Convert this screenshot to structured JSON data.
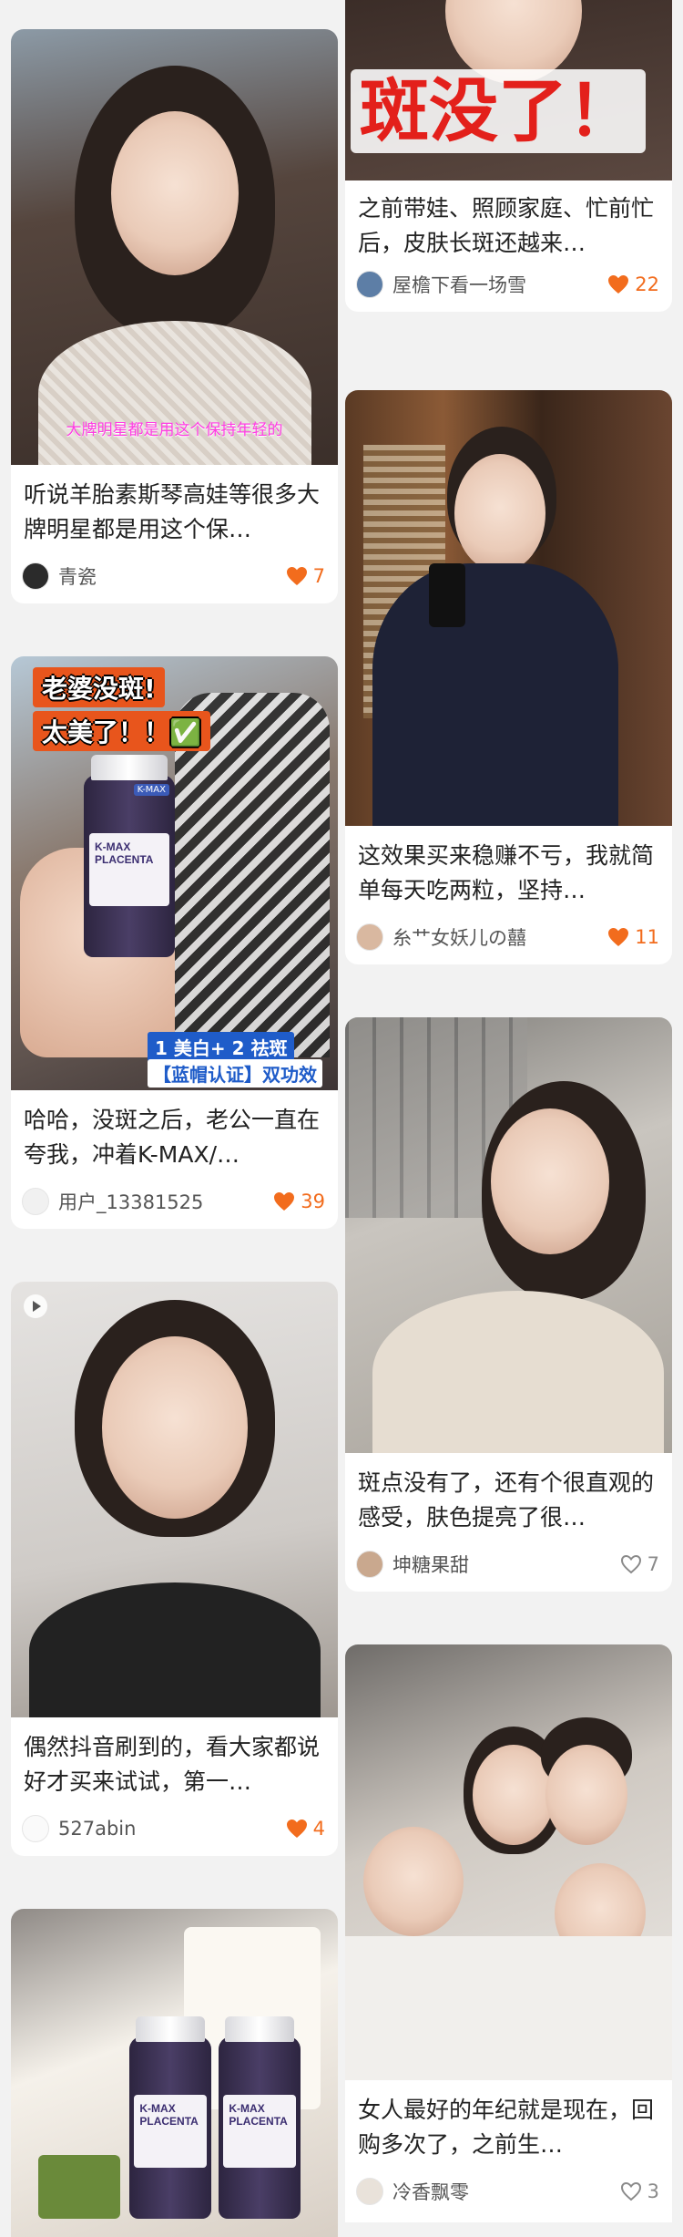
{
  "colors": {
    "like_active": "#f26c1d",
    "like_inactive": "#8a8a8a",
    "background": "#f2f2f2"
  },
  "cards": {
    "left": [
      {
        "title": "听说羊胎素斯琴高娃等很多大牌明星都是用这个保…",
        "user": "青瓷",
        "likes": "7",
        "liked": true,
        "image_caption": "大牌明星都是用这个保持年轻的"
      },
      {
        "title": "哈哈，没斑之后，老公一直在夸我，冲着K-MAX/…",
        "user": "用户_13381525",
        "likes": "39",
        "liked": true,
        "sticker_1": "老婆没斑!",
        "sticker_2": "太美了！！✅",
        "bottle_brand": "K-MAX",
        "bottle_line1": "K-MAX",
        "bottle_line2": "PLACENTA",
        "badge_1": "1 美白+ 2 祛斑",
        "badge_2": "【蓝帽认证】双功效"
      },
      {
        "title": "偶然抖音刷到的，看大家都说好才买来试试，第一…",
        "user": "527abin",
        "likes": "4",
        "liked": true,
        "has_video": true
      },
      {
        "title": "",
        "user": "",
        "likes": "",
        "bottle_line1": "K-MAX",
        "bottle_line2": "PLACENTA"
      }
    ],
    "right": [
      {
        "title": "之前带娃、照顾家庭、忙前忙后，皮肤长斑还越来…",
        "user": "屋檐下看一场雪",
        "likes": "22",
        "liked": true,
        "banner": "斑没了！"
      },
      {
        "title": "这效果买来稳赚不亏，我就简单每天吃两粒，坚持…",
        "user": "糸艹女妖儿の囍",
        "likes": "11",
        "liked": true
      },
      {
        "title": "斑点没有了，还有个很直观的感受，肤色提亮了很…",
        "user": "坤糖果甜",
        "likes": "7",
        "liked": false
      },
      {
        "title": "女人最好的年纪就是现在，回购多次了，之前生…",
        "user": "冷香飘零",
        "likes": "3",
        "liked": false
      }
    ]
  }
}
